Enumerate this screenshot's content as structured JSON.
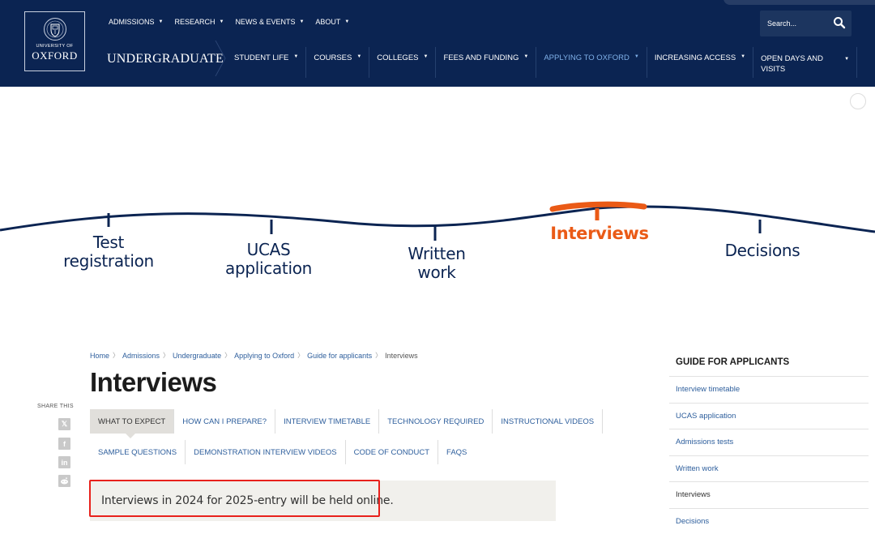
{
  "header": {
    "logo": {
      "line1": "UNIVERSITY OF",
      "line2": "OXFORD"
    },
    "top_nav": [
      {
        "label": "ADMISSIONS"
      },
      {
        "label": "RESEARCH"
      },
      {
        "label": "NEWS & EVENTS"
      },
      {
        "label": "ABOUT"
      }
    ],
    "search": {
      "placeholder": "Search..."
    },
    "section_title": "UNDERGRADUATE",
    "main_nav": [
      {
        "label": "STUDENT LIFE"
      },
      {
        "label": "COURSES"
      },
      {
        "label": "COLLEGES"
      },
      {
        "label": "FEES AND FUNDING"
      },
      {
        "label": "APPLYING TO OXFORD"
      },
      {
        "label": "INCREASING ACCESS"
      },
      {
        "label": "OPEN DAYS AND VISITS"
      }
    ],
    "colors": {
      "navy": "#0b2452",
      "active_link": "#7fb0e8"
    }
  },
  "timeline": {
    "stages": [
      {
        "line1": "Test",
        "line2": "registration"
      },
      {
        "line1": "UCAS",
        "line2": "application"
      },
      {
        "line1": "Written",
        "line2": "work"
      },
      {
        "line1": "Interviews",
        "line2": ""
      },
      {
        "line1": "Decisions",
        "line2": ""
      }
    ],
    "active_color": "#ea5a16"
  },
  "breadcrumb": [
    "Home",
    "Admissions",
    "Undergraduate",
    "Applying to Oxford",
    "Guide for applicants",
    "Interviews"
  ],
  "page_title": "Interviews",
  "share": {
    "label": "SHARE THIS"
  },
  "tabs": [
    "WHAT TO EXPECT",
    "HOW CAN I PREPARE?",
    "INTERVIEW TIMETABLE",
    "TECHNOLOGY REQUIRED",
    "INSTRUCTIONAL VIDEOS",
    "SAMPLE QUESTIONS",
    "DEMONSTRATION INTERVIEW VIDEOS",
    "CODE OF CONDUCT",
    "FAQS"
  ],
  "notice": "Interviews in 2024 for 2025-entry will be held online.",
  "sidebar": {
    "title": "GUIDE FOR APPLICANTS",
    "items": [
      "Interview timetable",
      "UCAS application",
      "Admissions tests",
      "Written work",
      "Interviews",
      "Decisions"
    ]
  }
}
